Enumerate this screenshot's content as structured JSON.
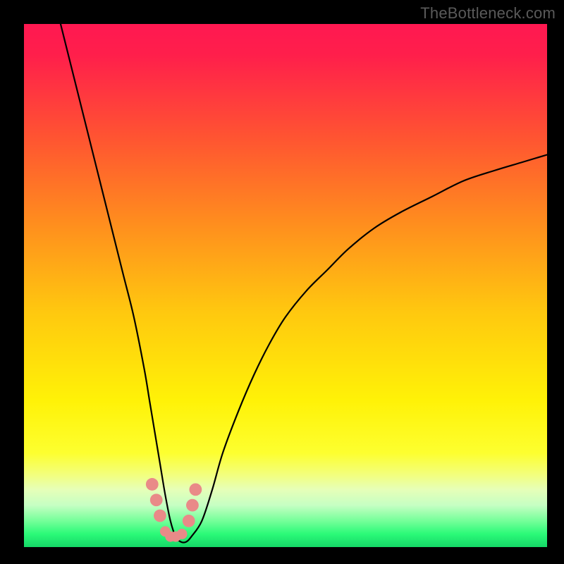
{
  "watermark": "TheBottleneck.com",
  "colors": {
    "frame": "#000000",
    "curve": "#000000",
    "dots": "#e98a88",
    "gradient_stops": [
      {
        "offset": 0.0,
        "color": "#ff1851"
      },
      {
        "offset": 0.06,
        "color": "#ff1f4b"
      },
      {
        "offset": 0.22,
        "color": "#ff5531"
      },
      {
        "offset": 0.38,
        "color": "#ff8d1e"
      },
      {
        "offset": 0.55,
        "color": "#ffc80f"
      },
      {
        "offset": 0.72,
        "color": "#fff207"
      },
      {
        "offset": 0.82,
        "color": "#fdff2f"
      },
      {
        "offset": 0.86,
        "color": "#f3ff7a"
      },
      {
        "offset": 0.89,
        "color": "#e6ffb8"
      },
      {
        "offset": 0.92,
        "color": "#c6ffc3"
      },
      {
        "offset": 0.95,
        "color": "#74ff99"
      },
      {
        "offset": 0.975,
        "color": "#2bfa78"
      },
      {
        "offset": 1.0,
        "color": "#15d767"
      }
    ]
  },
  "chart_data": {
    "type": "line",
    "title": "",
    "xlabel": "",
    "ylabel": "",
    "xlim": [
      0,
      100
    ],
    "ylim": [
      0,
      100
    ],
    "grid": false,
    "legend": false,
    "series": [
      {
        "name": "curve",
        "x": [
          7,
          9,
          11,
          13,
          15,
          17,
          19,
          21,
          23,
          24,
          25,
          26,
          27,
          28,
          29,
          30,
          31,
          32,
          34,
          36,
          38,
          41,
          44,
          47,
          50,
          54,
          58,
          62,
          67,
          72,
          78,
          84,
          90,
          95,
          100
        ],
        "y": [
          100,
          92,
          84,
          76,
          68,
          60,
          52,
          44,
          34,
          28,
          22,
          16,
          10,
          5,
          2,
          1,
          1,
          2,
          5,
          11,
          18,
          26,
          33,
          39,
          44,
          49,
          53,
          57,
          61,
          64,
          67,
          70,
          72,
          73.5,
          75
        ]
      }
    ],
    "highlight_dots": {
      "name": "dots",
      "x": [
        24.5,
        25.3,
        26.0,
        27.0,
        28.0,
        29.0,
        30.2,
        31.5,
        32.2,
        32.8
      ],
      "y": [
        12.0,
        9.0,
        6.0,
        3.0,
        2.0,
        2.0,
        2.5,
        5.0,
        8.0,
        11.0
      ],
      "r": [
        1.2,
        1.2,
        1.2,
        1.0,
        1.0,
        1.0,
        1.0,
        1.2,
        1.2,
        1.2
      ]
    }
  }
}
